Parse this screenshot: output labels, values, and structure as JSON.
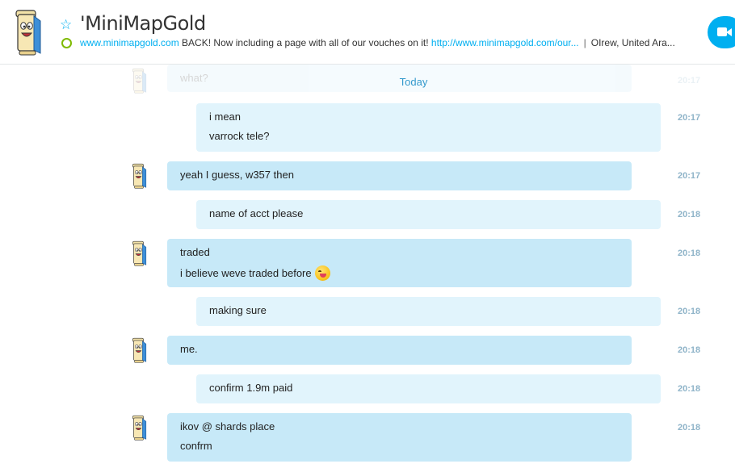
{
  "header": {
    "contact_name": "'MiniMapGold",
    "mood_link1": "www.minimapgold.com",
    "mood_text": " BACK! Now including a page with all of our vouches on it! ",
    "mood_link2": "http://www.minimapgold.com/our...",
    "separator": "|",
    "location": "OIrew, United Ara..."
  },
  "faded_message": {
    "text": "what?",
    "time": "20:17"
  },
  "date_divider": "Today",
  "messages": [
    {
      "dir": "out",
      "lines": [
        "i mean",
        "varrock tele?"
      ],
      "time": "20:17"
    },
    {
      "dir": "in",
      "lines": [
        "yeah I guess, w357 then"
      ],
      "time": "20:17"
    },
    {
      "dir": "out",
      "lines": [
        "name of acct please"
      ],
      "time": "20:18"
    },
    {
      "dir": "in",
      "lines": [
        "traded",
        "i believe weve traded before"
      ],
      "emoji": "tongue-wink-emoji",
      "time": "20:18"
    },
    {
      "dir": "out",
      "lines": [
        "making sure"
      ],
      "time": "20:18"
    },
    {
      "dir": "in",
      "lines": [
        "me."
      ],
      "time": "20:18"
    },
    {
      "dir": "out",
      "lines": [
        "confirm 1.9m paid"
      ],
      "time": "20:18"
    },
    {
      "dir": "in",
      "lines": [
        "ikov @ shards place",
        "confrm"
      ],
      "time": "20:18"
    }
  ],
  "icons": {
    "favorite": "star-icon",
    "status": "online-status-icon",
    "video_call": "video-camera-icon",
    "avatar": "scroll-avatar-icon"
  },
  "colors": {
    "accent": "#00aff0",
    "incoming_bubble": "#c7e9f8",
    "outgoing_bubble": "#e1f4fc",
    "timestamp": "#8fb4c9",
    "status_online": "#7fba00"
  }
}
